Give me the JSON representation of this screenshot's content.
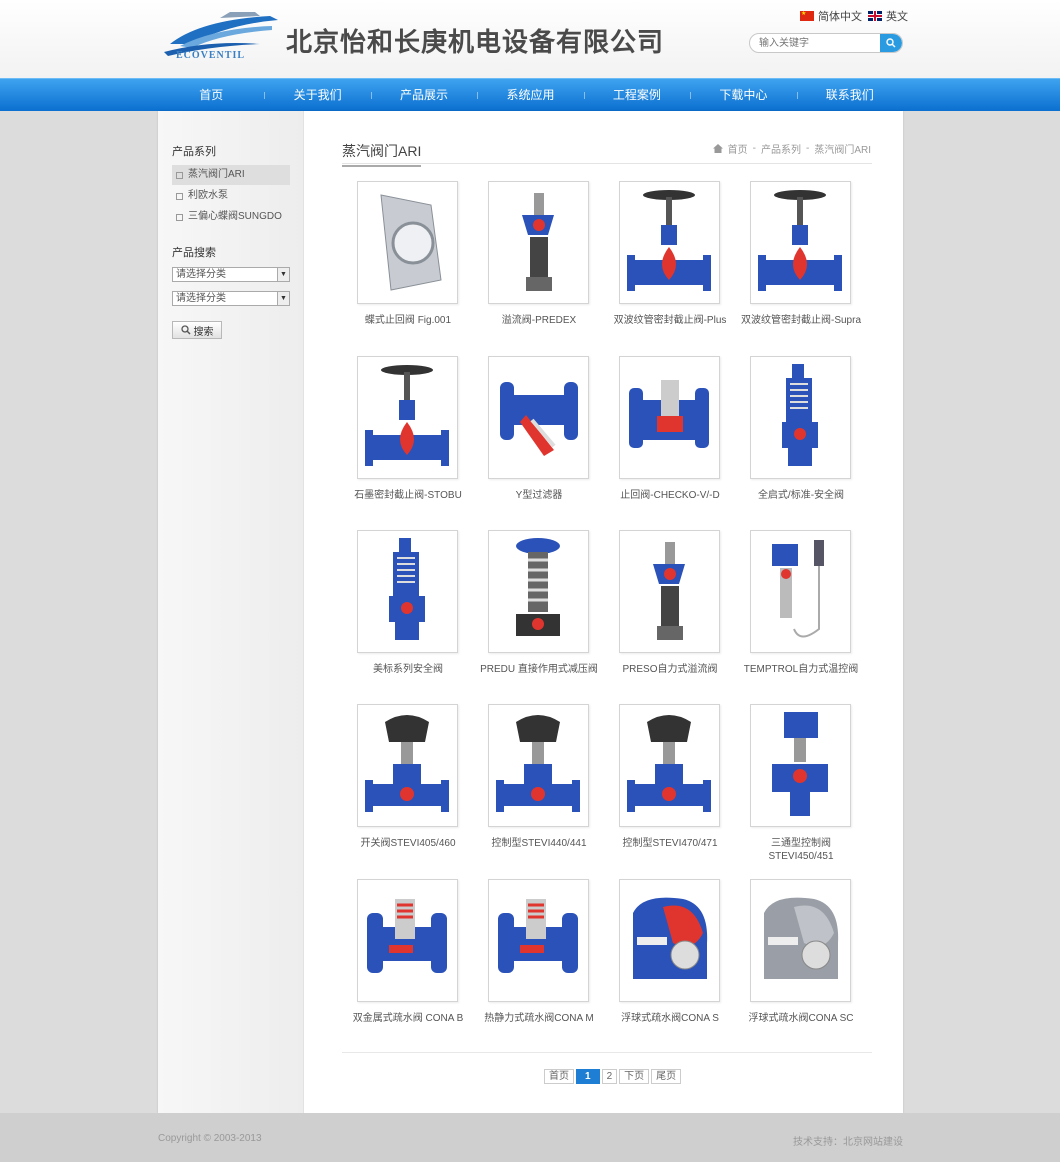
{
  "header": {
    "logo_text": "ECOVENTIL",
    "company_name": "北京怡和长庚机电设备有限公司",
    "lang_cn": "简体中文",
    "lang_en": "英文",
    "search_placeholder": "输入关键字"
  },
  "nav": [
    "首页",
    "关于我们",
    "产品展示",
    "系统应用",
    "工程案例",
    "下载中心",
    "联系我们"
  ],
  "sidebar": {
    "series_title": "产品系列",
    "series": [
      "蒸汽阀门ARI",
      "利欧水泵",
      "三偏心蝶阀SUNGDO"
    ],
    "search_title": "产品搜索",
    "select1": "请选择分类",
    "select2": "请选择分类",
    "search_button": "搜索"
  },
  "content": {
    "title": "蒸汽阀门ARI",
    "breadcrumb": [
      "首页",
      "-",
      "产品系列",
      "-",
      "蒸汽阀门ARI"
    ]
  },
  "products": [
    {
      "name": "蝶式止回阀 Fig.001",
      "icon": "wafer-check-valve-icon"
    },
    {
      "name": "溢流阀-PREDEX",
      "icon": "overflow-valve-icon"
    },
    {
      "name": "双波纹管密封截止阀-Plus",
      "icon": "globe-valve-icon"
    },
    {
      "name": "双波纹管密封截止阀-Supra",
      "icon": "globe-valve-icon"
    },
    {
      "name": "石墨密封截止阀-STOBU",
      "icon": "globe-valve-icon"
    },
    {
      "name": "Y型过滤器",
      "icon": "strainer-icon"
    },
    {
      "name": "止回阀-CHECKO-V/-D",
      "icon": "check-valve-icon"
    },
    {
      "name": "全启式/标准-安全阀",
      "icon": "safety-valve-icon"
    },
    {
      "name": "美标系列安全阀",
      "icon": "safety-valve-icon"
    },
    {
      "name": "PREDU 直接作用式减压阀",
      "icon": "pressure-reducing-valve-icon"
    },
    {
      "name": "PRESO自力式溢流阀",
      "icon": "overflow-valve-icon"
    },
    {
      "name": "TEMPTROL自力式温控阀",
      "icon": "temperature-valve-icon"
    },
    {
      "name": "开关阀STEVI405/460",
      "icon": "actuated-valve-icon"
    },
    {
      "name": "控制型STEVI440/441",
      "icon": "actuated-valve-icon"
    },
    {
      "name": "控制型STEVI470/471",
      "icon": "actuated-valve-icon"
    },
    {
      "name": "三通型控制阀STEVI450/451",
      "icon": "three-way-valve-icon"
    },
    {
      "name": "双金属式疏水阀 CONA B",
      "icon": "steam-trap-icon"
    },
    {
      "name": "热静力式疏水阀CONA M",
      "icon": "steam-trap-icon"
    },
    {
      "name": "浮球式疏水阀CONA S",
      "icon": "float-trap-icon"
    },
    {
      "name": "浮球式疏水阀CONA SC",
      "icon": "float-trap-icon"
    }
  ],
  "pagination": {
    "first": "首页",
    "current": "1",
    "page2": "2",
    "next": "下页",
    "last": "尾页"
  },
  "footer": {
    "copyright": "Copyright © 2003-2013",
    "support": "技术支持：北京网站建设"
  },
  "colors": {
    "nav_top": "#3ea3ef",
    "nav_bottom": "#0b6fd0",
    "valve_blue": "#2a52b8",
    "valve_red": "#e0352e"
  }
}
